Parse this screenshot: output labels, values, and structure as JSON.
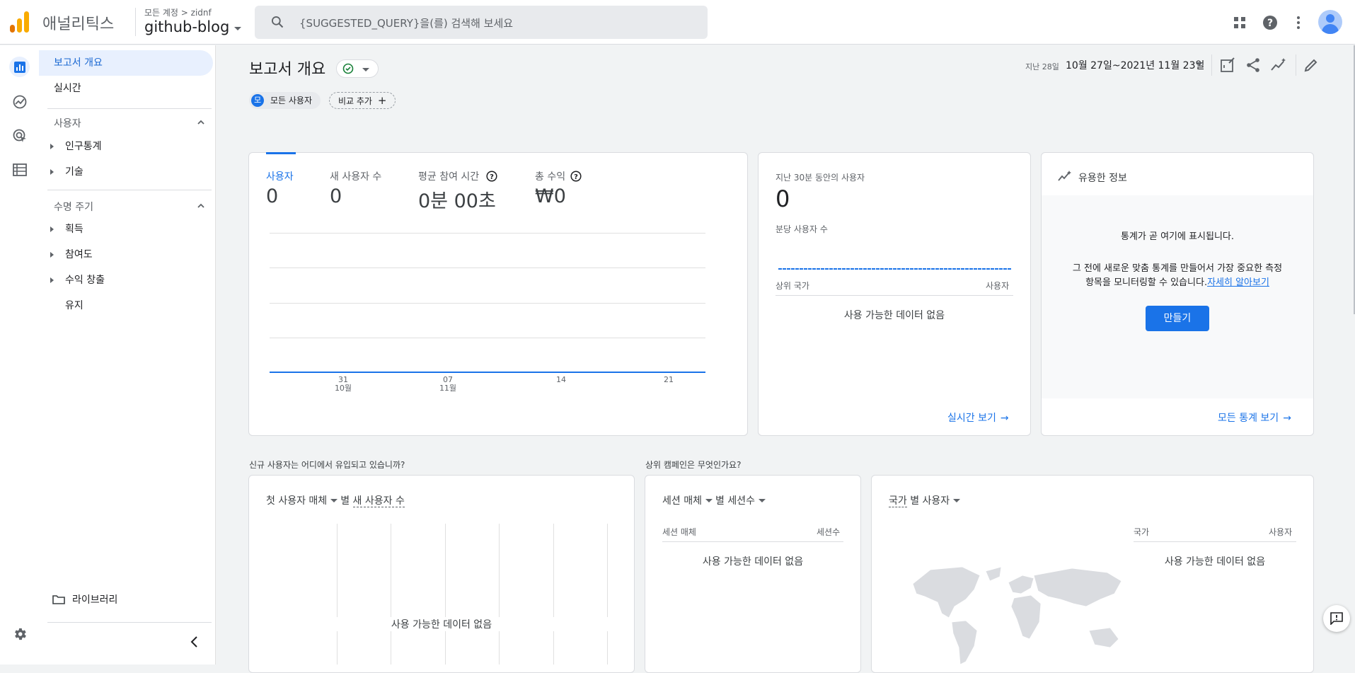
{
  "header": {
    "app_name": "애널리틱스",
    "account_path": "모든 계정 > zidnf",
    "property": "github-blog",
    "search_placeholder": "{SUGGESTED_QUERY}을(를) 검색해 보세요",
    "icons": [
      "apps-icon",
      "help-icon",
      "more-vert-icon",
      "account-avatar"
    ]
  },
  "rail": {
    "items": [
      "reports-icon",
      "explore-icon",
      "advertising-icon",
      "configure-icon"
    ],
    "settings": "settings-icon"
  },
  "sidebar": {
    "report_overview": "보고서 개요",
    "realtime": "실시간",
    "user_section": "사용자",
    "demographics": "인구통계",
    "tech": "기술",
    "lifecycle_section": "수명 주기",
    "acquisition": "획득",
    "engagement": "참여도",
    "monetization": "수익 창출",
    "retention": "유지",
    "library": "라이브러리"
  },
  "page": {
    "title": "보고서 개요",
    "date_small": "지난 28일",
    "date_range": "10월 27일~2021년 11월 23일",
    "segment_badge": "모",
    "segment": "모든 사용자",
    "compare": "비교 추가"
  },
  "metrics": [
    {
      "label": "사용자",
      "value": "0"
    },
    {
      "label": "새 사용자 수",
      "value": "0"
    },
    {
      "label": "평균 참여 시간",
      "value": "0분 00초"
    },
    {
      "label": "총 수익",
      "value": "₩0"
    }
  ],
  "chart_data": {
    "type": "line",
    "x": [
      "31\n10월",
      "07\n11월",
      "14",
      "21"
    ],
    "series": [
      {
        "values": [
          0,
          0,
          0,
          0
        ]
      }
    ]
  },
  "realtime_card": {
    "title": "지난 30분 동안의 사용자",
    "value": "0",
    "per_minute": "분당 사용자 수",
    "col_country": "상위 국가",
    "col_users": "사용자",
    "nodata": "사용 가능한 데이터 없음",
    "link": "실시간 보기"
  },
  "insights_card": {
    "title": "유용한 정보",
    "line1": "통계가 곧 여기에 표시됩니다.",
    "line2": "그 전에 새로운 맞춤 통계를 만들어서 가장 중요한 측정",
    "line3": "항목을 모니터링할 수 있습니다.",
    "learn_more": "자세히 알아보기",
    "create": "만들기",
    "link": "모든 통계 보기"
  },
  "bottom": {
    "q1": "신규 사용자는 어디에서 유입되고 있습니까?",
    "q2": "상위 캠페인은 무엇인가요?",
    "card1_dim": "첫 사용자 매체",
    "card1_by": "별",
    "card1_metric": "새 사용자 수",
    "card1_nodata": "사용 가능한 데이터 없음",
    "card2_dim": "세션 매체",
    "card2_metric": "별 세션수",
    "card2_col1": "세션 매체",
    "card2_col2": "세션수",
    "card2_nodata": "사용 가능한 데이터 없음",
    "card3_dim": "국가",
    "card3_metric": "별 사용자",
    "card3_col1": "국가",
    "card3_col2": "사용자",
    "card3_nodata": "사용 가능한 데이터 없음"
  },
  "colors": {
    "accent": "#1a73e8",
    "logo_orange": "#f9ab00",
    "logo_dark": "#e37400"
  }
}
